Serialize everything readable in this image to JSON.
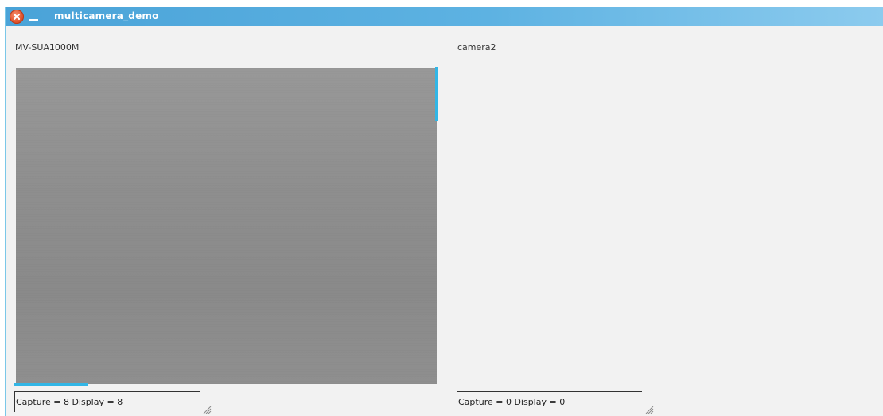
{
  "window": {
    "title": "multicamera_demo",
    "icons": {
      "close": "close-icon",
      "minimize": "minimize-icon",
      "resize_grip": "resize-grip-icon"
    }
  },
  "camera1": {
    "name": "MV-SUA1000M",
    "status": "Capture = 8  Display = 8"
  },
  "camera2": {
    "name": "camera2",
    "status": "Capture = 0  Display = 0"
  },
  "colors": {
    "titlebar": "#4aa3d8",
    "accent": "#32b6e6",
    "close": "#e0532c",
    "background": "#f2f2f2"
  }
}
